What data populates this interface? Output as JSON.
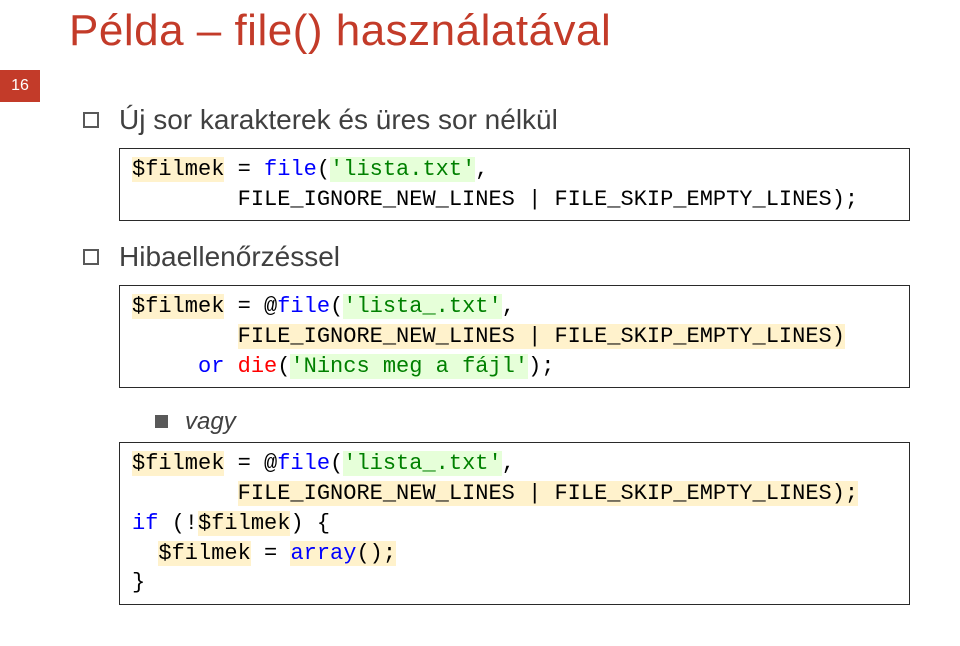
{
  "page_number": "16",
  "title": "Példa – file() használatával",
  "bullets": {
    "b1": "Új sor karakterek és üres sor nélkül",
    "b2": "Hibaellenőrzéssel",
    "sub_vagy": "vagy"
  },
  "code1": {
    "var": "$filmek",
    "eq": " = ",
    "fn": "file",
    "open": "(",
    "str": "'lista.txt'",
    "comma": ",",
    "flags": "FILE_IGNORE_NEW_LINES | FILE_SKIP_EMPTY_LINES);"
  },
  "code2": {
    "var": "$filmek",
    "eq": " = @",
    "fn": "file",
    "open": "(",
    "str": "'lista_.txt'",
    "comma": ",",
    "flags": "FILE_IGNORE_NEW_LINES | FILE_SKIP_EMPTY_LINES)",
    "or": "or",
    "die": "die",
    "die_open": "(",
    "die_str": "'Nincs meg a fájl'",
    "die_close": ");"
  },
  "code3": {
    "var": "$filmek",
    "eq": " = @",
    "fn": "file",
    "open": "(",
    "str": "'lista_.txt'",
    "comma": ",",
    "flags": "FILE_IGNORE_NEW_LINES | FILE_SKIP_EMPTY_LINES);",
    "if": "if",
    "neg": " (!",
    "var2": "$filmek",
    "if_close": ") {",
    "indent": "  ",
    "var3": "$filmek",
    "eq2": " = ",
    "arr": "array",
    "arr_tail": "();",
    "close": "}"
  }
}
